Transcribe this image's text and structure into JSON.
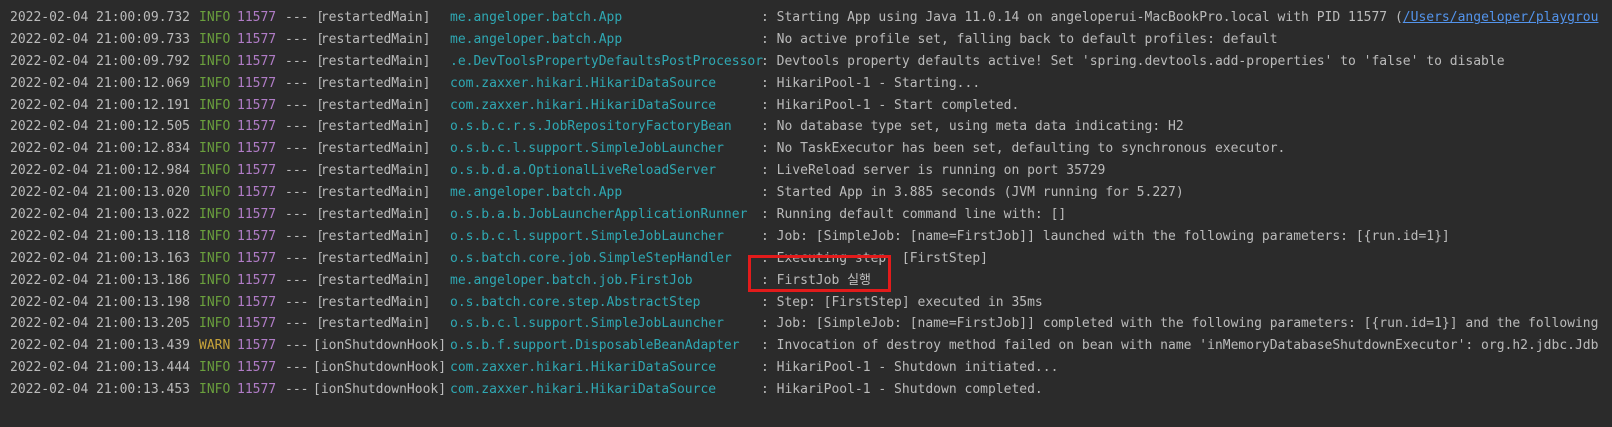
{
  "console": {
    "lines": [
      {
        "timestamp": "2022-02-04 21:00:09.732",
        "level": "INFO",
        "pid": "11577",
        "sep": "--- [",
        "thread": " restartedMain]",
        "logger": "me.angeloper.batch.App",
        "message": ": Starting App using Java 11.0.14 on angeloperui-MacBookPro.local with PID 11577 (",
        "link": "/Users/angeloper/playgrou"
      },
      {
        "timestamp": "2022-02-04 21:00:09.733",
        "level": "INFO",
        "pid": "11577",
        "sep": "--- [",
        "thread": " restartedMain]",
        "logger": "me.angeloper.batch.App",
        "message": ": No active profile set, falling back to default profiles: default"
      },
      {
        "timestamp": "2022-02-04 21:00:09.792",
        "level": "INFO",
        "pid": "11577",
        "sep": "--- [",
        "thread": " restartedMain]",
        "logger": ".e.DevToolsPropertyDefaultsPostProcessor",
        "message": ": Devtools property defaults active! Set 'spring.devtools.add-properties' to 'false' to disable"
      },
      {
        "timestamp": "2022-02-04 21:00:12.069",
        "level": "INFO",
        "pid": "11577",
        "sep": "--- [",
        "thread": " restartedMain]",
        "logger": "com.zaxxer.hikari.HikariDataSource",
        "message": ": HikariPool-1 - Starting..."
      },
      {
        "timestamp": "2022-02-04 21:00:12.191",
        "level": "INFO",
        "pid": "11577",
        "sep": "--- [",
        "thread": " restartedMain]",
        "logger": "com.zaxxer.hikari.HikariDataSource",
        "message": ": HikariPool-1 - Start completed."
      },
      {
        "timestamp": "2022-02-04 21:00:12.505",
        "level": "INFO",
        "pid": "11577",
        "sep": "--- [",
        "thread": " restartedMain]",
        "logger": "o.s.b.c.r.s.JobRepositoryFactoryBean",
        "message": ": No database type set, using meta data indicating: H2"
      },
      {
        "timestamp": "2022-02-04 21:00:12.834",
        "level": "INFO",
        "pid": "11577",
        "sep": "--- [",
        "thread": " restartedMain]",
        "logger": "o.s.b.c.l.support.SimpleJobLauncher",
        "message": ": No TaskExecutor has been set, defaulting to synchronous executor."
      },
      {
        "timestamp": "2022-02-04 21:00:12.984",
        "level": "INFO",
        "pid": "11577",
        "sep": "--- [",
        "thread": " restartedMain]",
        "logger": "o.s.b.d.a.OptionalLiveReloadServer",
        "message": ": LiveReload server is running on port 35729"
      },
      {
        "timestamp": "2022-02-04 21:00:13.020",
        "level": "INFO",
        "pid": "11577",
        "sep": "--- [",
        "thread": " restartedMain]",
        "logger": "me.angeloper.batch.App",
        "message": ": Started App in 3.885 seconds (JVM running for 5.227)"
      },
      {
        "timestamp": "2022-02-04 21:00:13.022",
        "level": "INFO",
        "pid": "11577",
        "sep": "--- [",
        "thread": " restartedMain]",
        "logger": "o.s.b.a.b.JobLauncherApplicationRunner",
        "message": ": Running default command line with: []"
      },
      {
        "timestamp": "2022-02-04 21:00:13.118",
        "level": "INFO",
        "pid": "11577",
        "sep": "--- [",
        "thread": " restartedMain]",
        "logger": "o.s.b.c.l.support.SimpleJobLauncher",
        "message": ": Job: [SimpleJob: [name=FirstJob]] launched with the following parameters: [{run.id=1}]"
      },
      {
        "timestamp": "2022-02-04 21:00:13.163",
        "level": "INFO",
        "pid": "11577",
        "sep": "--- [",
        "thread": " restartedMain]",
        "logger": "o.s.batch.core.job.SimpleStepHandler",
        "message": ": Executing step: [FirstStep]"
      },
      {
        "timestamp": "2022-02-04 21:00:13.186",
        "level": "INFO",
        "pid": "11577",
        "sep": "--- [",
        "thread": " restartedMain]",
        "logger": "me.angeloper.batch.job.FirstJob",
        "message": ": FirstJob 실행"
      },
      {
        "timestamp": "2022-02-04 21:00:13.198",
        "level": "INFO",
        "pid": "11577",
        "sep": "--- [",
        "thread": " restartedMain]",
        "logger": "o.s.batch.core.step.AbstractStep",
        "message": ": Step: [FirstStep] executed in 35ms"
      },
      {
        "timestamp": "2022-02-04 21:00:13.205",
        "level": "INFO",
        "pid": "11577",
        "sep": "--- [",
        "thread": " restartedMain]",
        "logger": "o.s.b.c.l.support.SimpleJobLauncher",
        "message": ": Job: [SimpleJob: [name=FirstJob]] completed with the following parameters: [{run.id=1}] and the following"
      },
      {
        "timestamp": "2022-02-04 21:00:13.439",
        "level": "WARN",
        "pid": "11577",
        "sep": "---",
        "thread": "[ionShutdownHook]",
        "logger": "o.s.b.f.support.DisposableBeanAdapter",
        "message": ": Invocation of destroy method failed on bean with name 'inMemoryDatabaseShutdownExecutor': org.h2.jdbc.Jdb"
      },
      {
        "timestamp": "2022-02-04 21:00:13.444",
        "level": "INFO",
        "pid": "11577",
        "sep": "---",
        "thread": "[ionShutdownHook]",
        "logger": "com.zaxxer.hikari.HikariDataSource",
        "message": ": HikariPool-1 - Shutdown initiated..."
      },
      {
        "timestamp": "2022-02-04 21:00:13.453",
        "level": "INFO",
        "pid": "11577",
        "sep": "---",
        "thread": "[ionShutdownHook]",
        "logger": "com.zaxxer.hikari.HikariDataSource",
        "message": ": HikariPool-1 - Shutdown completed."
      }
    ],
    "highlighted_line_index": 12
  },
  "colors": {
    "background": "#2b2b2b",
    "text": "#bbbbbb",
    "info": "#6a9f3d",
    "warn": "#c7a33a",
    "pid": "#b07cc6",
    "logger": "#2fa8b3",
    "link": "#5394ec",
    "highlight_border": "#e21b1b"
  }
}
